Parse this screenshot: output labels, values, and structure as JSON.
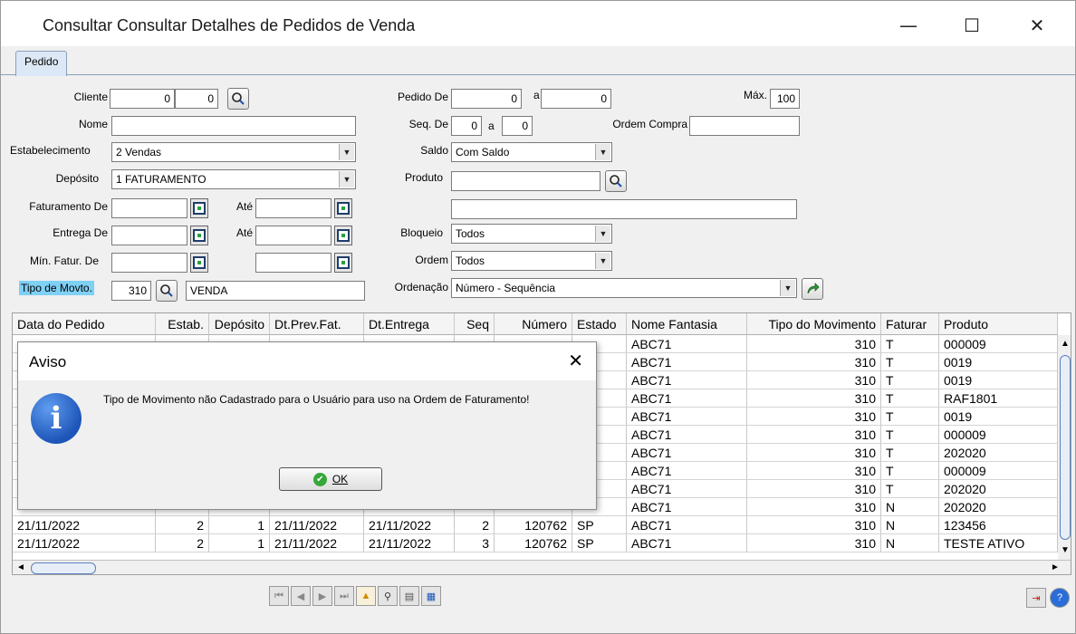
{
  "window": {
    "title": "Consultar Consultar Detalhes de Pedidos de Venda",
    "minimize_glyph": "—",
    "maximize_glyph": "☐",
    "close_glyph": "✕"
  },
  "tabs": [
    {
      "label": "Pedido"
    }
  ],
  "form": {
    "cliente_label": "Cliente",
    "cliente_a": "0",
    "cliente_b": "0",
    "nome_label": "Nome",
    "nome_value": "",
    "estabelecimento_label": "Estabelecimento",
    "estabelecimento_value": "2 Vendas",
    "deposito_label": "Depósito",
    "deposito_value": "1 FATURAMENTO",
    "faturamento_de_label": "Faturamento De",
    "ate_label_1": "Até",
    "entrega_de_label": "Entrega De",
    "ate_label_2": "Até",
    "min_fatur_label": "Mín. Fatur. De",
    "tipo_movto_label": "Tipo de Movto.",
    "tipo_movto_code": "310",
    "tipo_movto_desc": "VENDA",
    "pedido_de_label": "Pedido De",
    "pedido_de_value": "0",
    "pedido_a_label": "a",
    "pedido_a_value": "0",
    "max_label": "Máx.",
    "max_value": "100",
    "seq_de_label": "Seq. De",
    "seq_de_value": "0",
    "seq_a_label": "a",
    "seq_a_value": "0",
    "ordem_compra_label": "Ordem Compra",
    "ordem_compra_value": "",
    "saldo_label": "Saldo",
    "saldo_value": "Com Saldo",
    "produto_label": "Produto",
    "bloqueio_label": "Bloqueio",
    "bloqueio_value": "Todos",
    "ordem_label": "Ordem",
    "ordem_value": "Todos",
    "ordenacao_label": "Ordenação",
    "ordenacao_value": "Número - Sequência"
  },
  "grid": {
    "columns": [
      "Data do Pedido",
      "Estab.",
      "Depósito",
      "Dt.Prev.Fat.",
      "Dt.Entrega",
      "Seq",
      "Número",
      "Estado",
      "Nome Fantasia",
      "Tipo do Movimento",
      "Faturar",
      "Produto"
    ],
    "rows": [
      [
        "",
        "",
        "",
        "",
        "",
        "",
        "",
        "",
        "ABC71",
        "310",
        "T",
        "000009"
      ],
      [
        "",
        "",
        "",
        "",
        "",
        "",
        "",
        "",
        "ABC71",
        "310",
        "T",
        "0019"
      ],
      [
        "",
        "",
        "",
        "",
        "",
        "",
        "",
        "",
        "ABC71",
        "310",
        "T",
        "0019"
      ],
      [
        "",
        "",
        "",
        "",
        "",
        "",
        "",
        "",
        "ABC71",
        "310",
        "T",
        "RAF1801"
      ],
      [
        "",
        "",
        "",
        "",
        "",
        "",
        "",
        "",
        "ABC71",
        "310",
        "T",
        "0019"
      ],
      [
        "",
        "",
        "",
        "",
        "",
        "",
        "",
        "",
        "ABC71",
        "310",
        "T",
        "000009"
      ],
      [
        "",
        "",
        "",
        "",
        "",
        "",
        "",
        "",
        "ABC71",
        "310",
        "T",
        "202020"
      ],
      [
        "",
        "",
        "",
        "",
        "",
        "",
        "",
        "",
        "ABC71",
        "310",
        "T",
        "000009"
      ],
      [
        "",
        "",
        "",
        "",
        "",
        "",
        "",
        "",
        "ABC71",
        "310",
        "T",
        "202020"
      ],
      [
        "",
        "",
        "",
        "",
        "",
        "",
        "",
        "",
        "ABC71",
        "310",
        "N",
        "202020"
      ],
      [
        "21/11/2022",
        "2",
        "1",
        "21/11/2022",
        "21/11/2022",
        "2",
        "120762",
        "SP",
        "ABC71",
        "310",
        "N",
        "123456"
      ],
      [
        "21/11/2022",
        "2",
        "1",
        "21/11/2022",
        "21/11/2022",
        "3",
        "120762",
        "SP",
        "ABC71",
        "310",
        "N",
        "TESTE ATIVO"
      ]
    ]
  },
  "dialog": {
    "title": "Aviso",
    "close_glyph": "✕",
    "message": "Tipo de Movimento não Cadastrado para o Usuário para uso na Ordem de Faturamento!",
    "icon_glyph": "i",
    "ok_label": "OK",
    "ok_glyph": "✔"
  },
  "colors": {
    "accent": "#1d55b8",
    "highlight": "#7fd0f5",
    "ok_green": "#36a83a"
  }
}
